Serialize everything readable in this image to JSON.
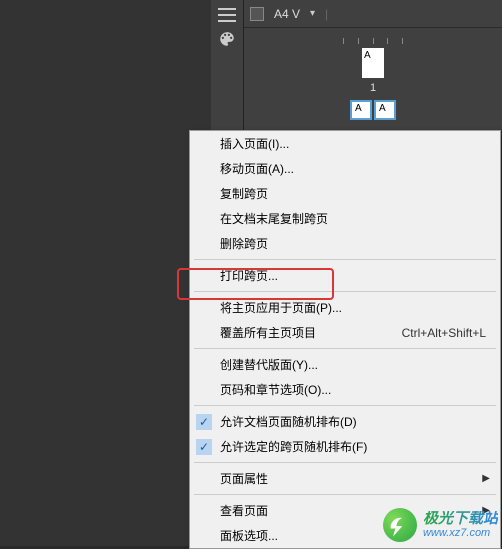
{
  "top": {
    "page_size": "A4 V"
  },
  "pages": {
    "master_label": "A",
    "page_number": "1",
    "spread_left": "A",
    "spread_right": "A"
  },
  "menu": {
    "insert_pages": "插入页面(I)...",
    "move_pages": "移动页面(A)...",
    "duplicate_spread": "复制跨页",
    "duplicate_at_end": "在文档末尾复制跨页",
    "delete_spread": "删除跨页",
    "print_spread": "打印跨页...",
    "apply_master": "将主页应用于页面(P)...",
    "override_master": "覆盖所有主页项目",
    "override_shortcut": "Ctrl+Alt+Shift+L",
    "create_alternate": "创建替代版面(Y)...",
    "page_section_options": "页码和章节选项(O)...",
    "allow_doc_shuffle": "允许文档页面随机排布(D)",
    "allow_spread_shuffle": "允许选定的跨页随机排布(F)",
    "page_attributes": "页面属性",
    "view_pages": "查看页面",
    "panel_options": "面板选项..."
  },
  "watermark": {
    "cn": "极光下载站",
    "url": "www.xz7.com"
  }
}
